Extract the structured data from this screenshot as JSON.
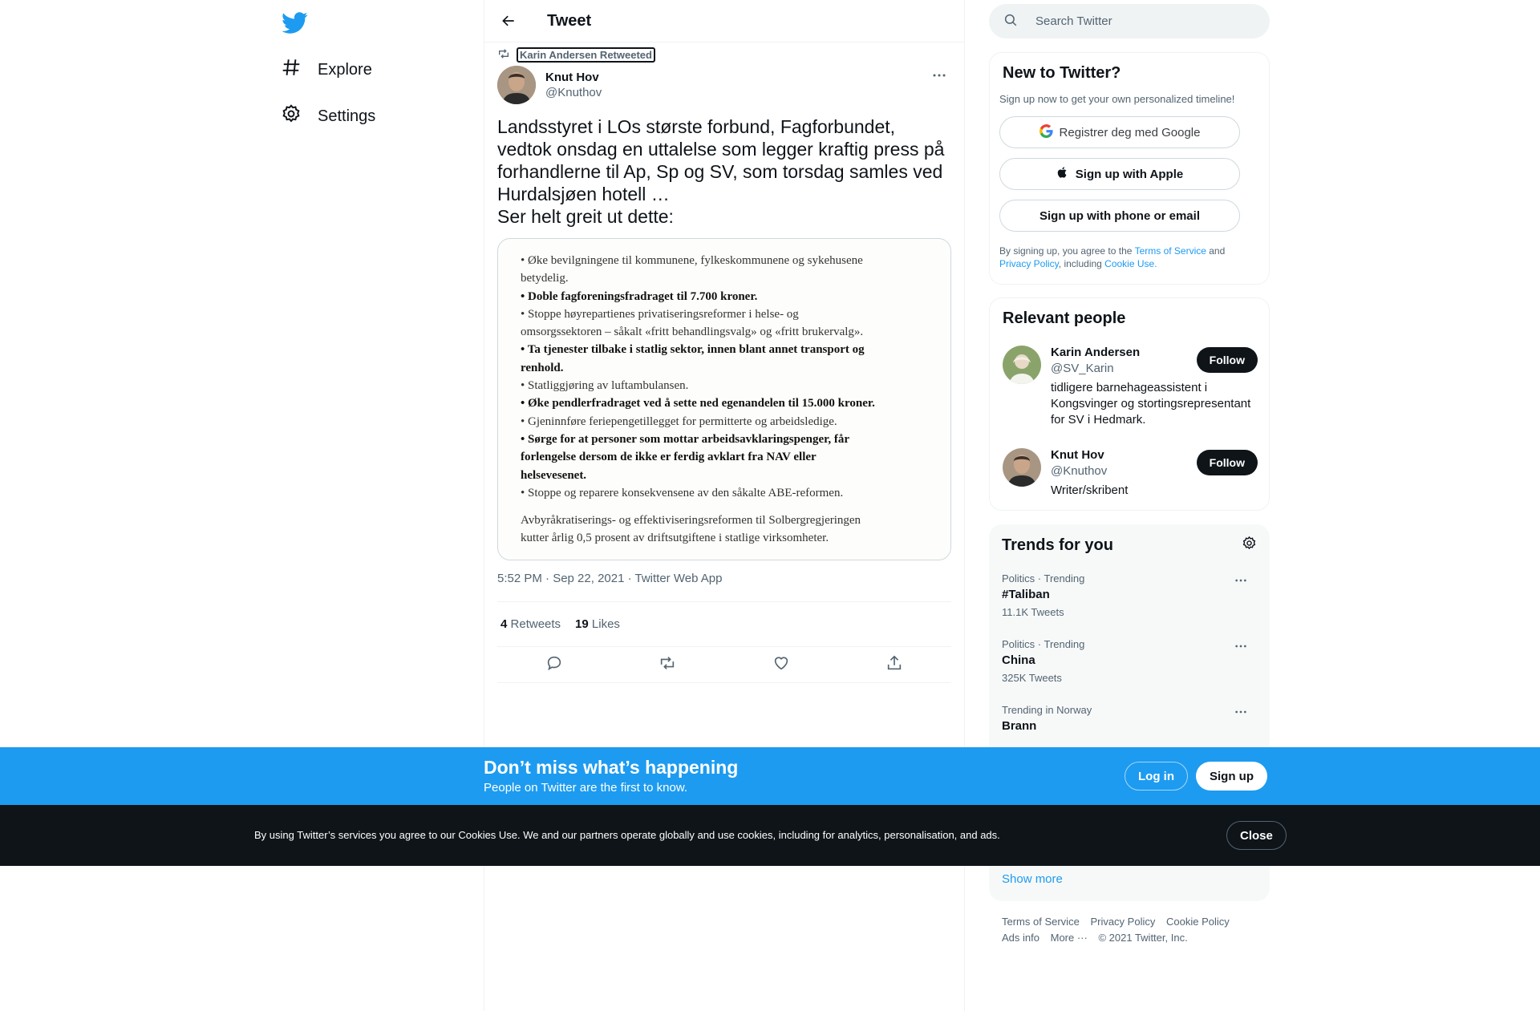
{
  "nav": {
    "explore_label": "Explore",
    "settings_label": "Settings"
  },
  "header": {
    "title": "Tweet"
  },
  "tweet": {
    "retweeted_by": "Karin Andersen Retweeted",
    "author_name": "Knut Hov",
    "author_handle": "@Knuthov",
    "text": "Landsstyret i LOs største forbund, Fagforbundet, vedtok onsdag en uttalelse som legger kraftig press på forhandlerne til Ap, Sp og SV, som torsdag samles ved Hurdalsjøen hotell …\nSer helt greit ut dette:",
    "media_lines": [
      {
        "text": "• Øke bevilgningene til kommunene, fylkeskommunene og sykehusene",
        "bold": false
      },
      {
        "text": "betydelig.",
        "bold": false
      },
      {
        "text": "• Doble fagforeningsfradraget til 7.700 kroner.",
        "bold": true
      },
      {
        "text": "• Stoppe høyrepartienes privatiseringsreformer i helse- og",
        "bold": false
      },
      {
        "text": "omsorgssektoren – såkalt «fritt behandlingsvalg» og «fritt brukervalg».",
        "bold": false
      },
      {
        "text": "• Ta tjenester tilbake i statlig sektor, innen blant annet transport og",
        "bold": true
      },
      {
        "text": "renhold.",
        "bold": true
      },
      {
        "text": "• Statliggjøring av luftambulansen.",
        "bold": false
      },
      {
        "text": "• Øke pendlerfradraget ved å sette ned egenandelen til 15.000 kroner.",
        "bold": true
      },
      {
        "text": "• Gjeninnføre feriepengetillegget for permitterte og arbeidsledige.",
        "bold": false
      },
      {
        "text": "• Sørge for at personer som mottar arbeidsavklaringspenger, får",
        "bold": true
      },
      {
        "text": "forlengelse dersom de ikke er ferdig avklart fra NAV eller",
        "bold": true
      },
      {
        "text": "helsevesenet.",
        "bold": true
      },
      {
        "text": "• Stoppe og reparere konsekvensene av den såkalte ABE-reformen.",
        "bold": false
      }
    ],
    "media_footer_lines": [
      "Avbyråkratiserings- og effektiviseringsreformen til Solbergregjeringen",
      "kutter årlig 0,5 prosent av driftsutgiftene i statlige virksomheter."
    ],
    "timestamp": "5:52 PM · Sep 22, 2021 · Twitter Web App",
    "retweets_count": "4",
    "retweets_label": "Retweets",
    "likes_count": "19",
    "likes_label": "Likes"
  },
  "search": {
    "placeholder": "Search Twitter"
  },
  "new_to_twitter": {
    "title": "New to Twitter?",
    "subtitle": "Sign up now to get your own personalized timeline!",
    "google_label": "Registrer deg med Google",
    "apple_label": "Sign up with Apple",
    "phone_label": "Sign up with phone or email",
    "terms_prefix": "By signing up, you agree to the ",
    "terms_link": "Terms of Service",
    "terms_and": " and ",
    "privacy_link": "Privacy Policy",
    "terms_including": ", including ",
    "cookie_link": "Cookie Use",
    "terms_end": "."
  },
  "relevant_people": {
    "title": "Relevant people",
    "people": [
      {
        "name": "Karin Andersen",
        "handle": "@SV_Karin",
        "bio": "tidligere barnehageassistent i Kongsvinger og stortingsrepresentant for SV i Hedmark.",
        "follow_label": "Follow"
      },
      {
        "name": "Knut Hov",
        "handle": "@Knuthov",
        "bio": "Writer/skribent",
        "follow_label": "Follow"
      }
    ]
  },
  "trends": {
    "title": "Trends for you",
    "items": [
      {
        "meta": "Politics · Trending",
        "name": "#Taliban",
        "count": "11.1K Tweets"
      },
      {
        "meta": "Politics · Trending",
        "name": "China",
        "count": "325K Tweets"
      },
      {
        "meta": "Trending in Norway",
        "name": "Brann",
        "count": ""
      }
    ],
    "show_more": "Show more"
  },
  "footer": {
    "terms": "Terms of Service",
    "privacy": "Privacy Policy",
    "cookie": "Cookie Policy",
    "ads": "Ads info",
    "more": "More ···",
    "copyright": "© 2021 Twitter, Inc."
  },
  "happening_banner": {
    "title": "Don’t miss what’s happening",
    "subtitle": "People on Twitter are the first to know.",
    "login_label": "Log in",
    "signup_label": "Sign up"
  },
  "cookie_banner": {
    "text": "By using Twitter’s services you agree to our Cookies Use. We and our partners operate globally and use cookies, including for analytics, personalisation, and ads.",
    "close_label": "Close"
  },
  "colors": {
    "brand_blue": "#1d9bf0",
    "dark": "#0f1419",
    "muted": "#536471"
  }
}
